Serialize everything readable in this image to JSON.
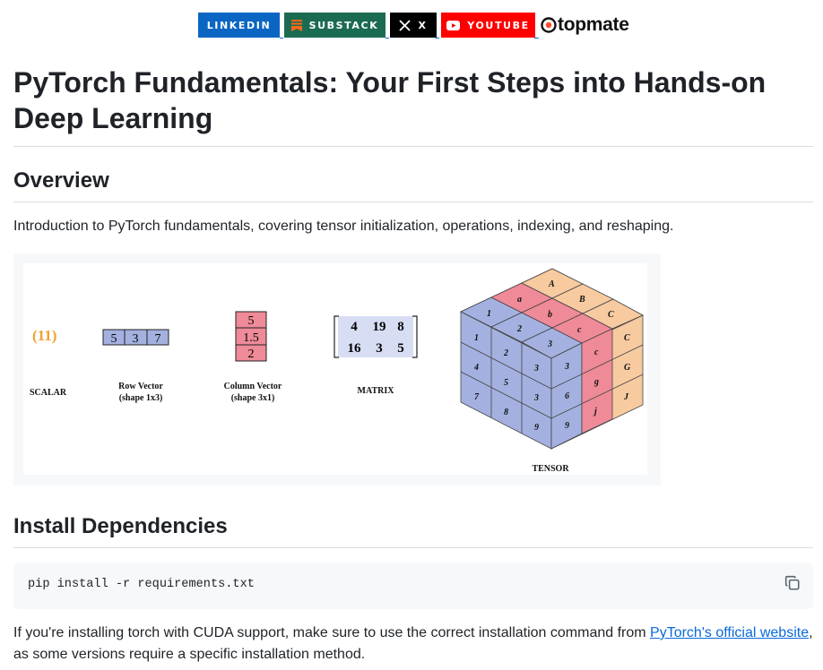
{
  "badges": {
    "linkedin": "LINKEDIN",
    "substack": "SUBSTACK",
    "x": "X",
    "youtube": "YOUTUBE",
    "topmate": "topmate"
  },
  "title": "PyTorch Fundamentals: Your First Steps into Hands-on Deep Learning",
  "overview": {
    "heading": "Overview",
    "text": "Introduction to PyTorch fundamentals, covering tensor initialization, operations, indexing, and reshaping."
  },
  "figure": {
    "scalar": {
      "value": "(11)",
      "label": "SCALAR"
    },
    "row_vector": {
      "values": [
        "5",
        "3",
        "7"
      ],
      "label": "Row Vector",
      "shape": "(shape 1x3)"
    },
    "column_vector": {
      "values": [
        "5",
        "1.5",
        "2"
      ],
      "label": "Column Vector",
      "shape": "(shape 3x1)"
    },
    "matrix": {
      "rows": [
        [
          "4",
          "19",
          "8"
        ],
        [
          "16",
          "3",
          "5"
        ]
      ],
      "label": "MATRIX"
    },
    "tensor": {
      "label": "TENSOR",
      "left_face": [
        "1",
        "2",
        "3",
        "4",
        "5",
        "3",
        "7",
        "8",
        "9"
      ],
      "right_face": [
        "c",
        "C",
        "g",
        "G",
        "j",
        "J"
      ],
      "right_face_back": [
        "3",
        "6",
        "9"
      ],
      "top_face": [
        "A",
        "B",
        "C",
        "a",
        "b",
        "c",
        "1",
        "2",
        "3"
      ]
    }
  },
  "install": {
    "heading": "Install Dependencies",
    "command": "pip install -r requirements.txt",
    "note_before": "If you're installing torch with CUDA support, make sure to use the correct installation command from ",
    "note_link": "PyTorch's official website",
    "note_after": ",",
    "note_line2": "as some versions require a specific installation method."
  },
  "colors": {
    "linkedin": "#0a66c2",
    "substack": "#1b6b52",
    "youtube": "#ff0000",
    "link": "#0969da",
    "tensor_blue": "#a4b1e0",
    "tensor_pink": "#ef8a99",
    "tensor_peach": "#f7caa0"
  }
}
